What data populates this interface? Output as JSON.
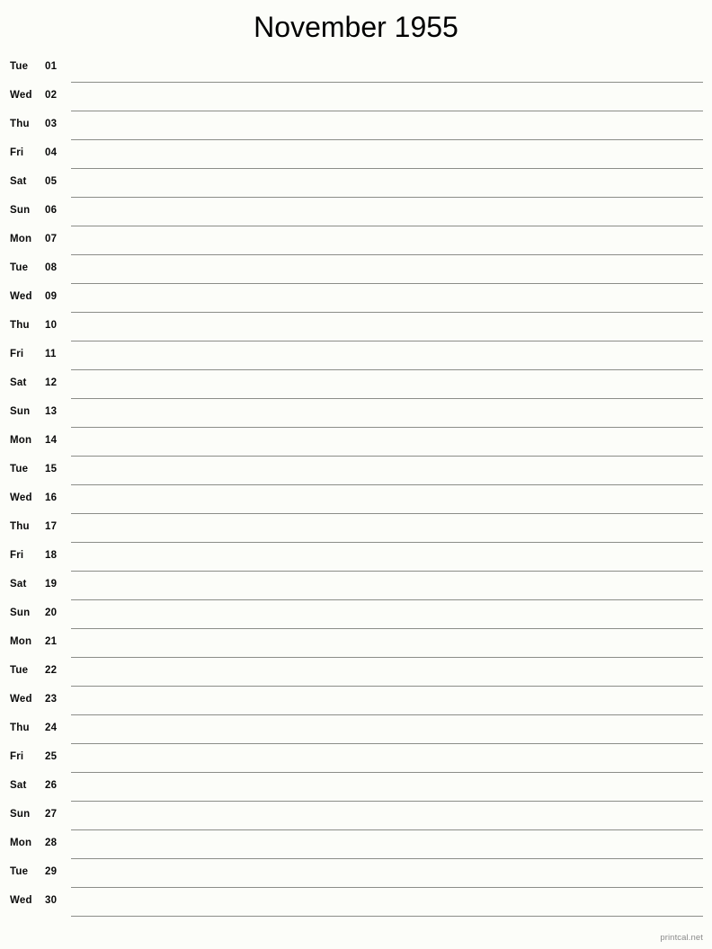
{
  "page": {
    "title": "November 1955",
    "footer": "printcal.net",
    "background_color": "#fcfdf9",
    "rule_color": "#8b8d88",
    "text_color": "#0a0a0a",
    "footer_color": "#8b8b8b"
  },
  "days": [
    {
      "weekday": "Tue",
      "date": "01"
    },
    {
      "weekday": "Wed",
      "date": "02"
    },
    {
      "weekday": "Thu",
      "date": "03"
    },
    {
      "weekday": "Fri",
      "date": "04"
    },
    {
      "weekday": "Sat",
      "date": "05"
    },
    {
      "weekday": "Sun",
      "date": "06"
    },
    {
      "weekday": "Mon",
      "date": "07"
    },
    {
      "weekday": "Tue",
      "date": "08"
    },
    {
      "weekday": "Wed",
      "date": "09"
    },
    {
      "weekday": "Thu",
      "date": "10"
    },
    {
      "weekday": "Fri",
      "date": "11"
    },
    {
      "weekday": "Sat",
      "date": "12"
    },
    {
      "weekday": "Sun",
      "date": "13"
    },
    {
      "weekday": "Mon",
      "date": "14"
    },
    {
      "weekday": "Tue",
      "date": "15"
    },
    {
      "weekday": "Wed",
      "date": "16"
    },
    {
      "weekday": "Thu",
      "date": "17"
    },
    {
      "weekday": "Fri",
      "date": "18"
    },
    {
      "weekday": "Sat",
      "date": "19"
    },
    {
      "weekday": "Sun",
      "date": "20"
    },
    {
      "weekday": "Mon",
      "date": "21"
    },
    {
      "weekday": "Tue",
      "date": "22"
    },
    {
      "weekday": "Wed",
      "date": "23"
    },
    {
      "weekday": "Thu",
      "date": "24"
    },
    {
      "weekday": "Fri",
      "date": "25"
    },
    {
      "weekday": "Sat",
      "date": "26"
    },
    {
      "weekday": "Sun",
      "date": "27"
    },
    {
      "weekday": "Mon",
      "date": "28"
    },
    {
      "weekday": "Tue",
      "date": "29"
    },
    {
      "weekday": "Wed",
      "date": "30"
    }
  ]
}
